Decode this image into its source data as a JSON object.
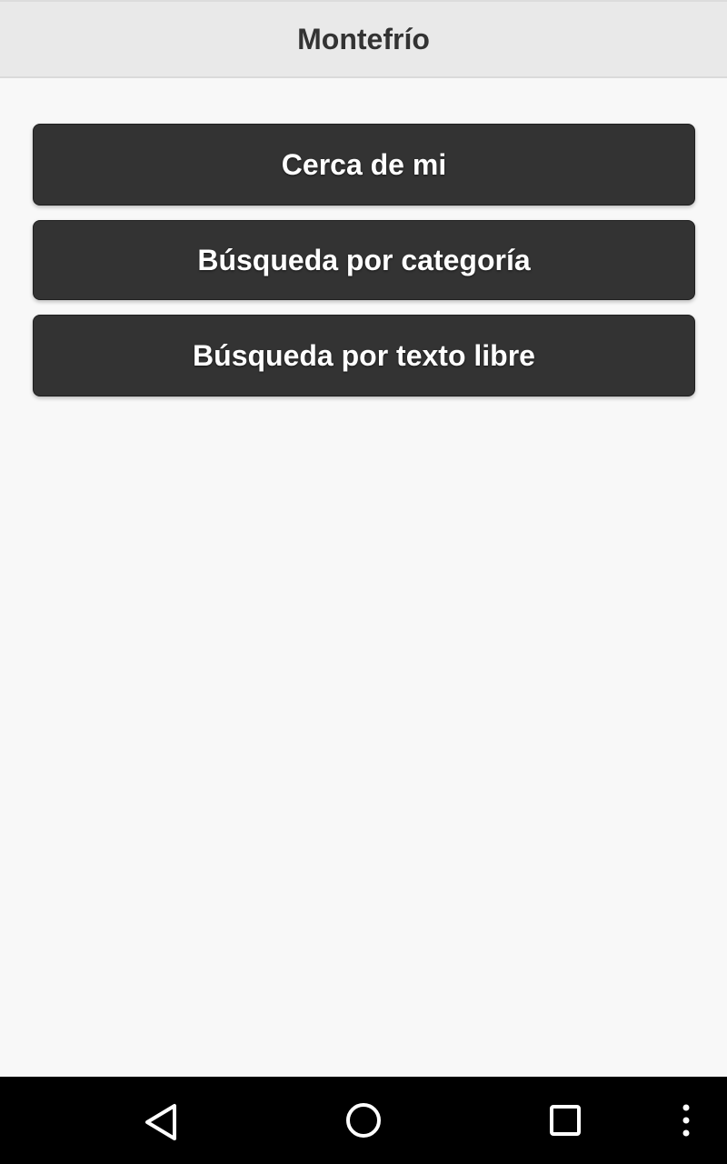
{
  "header": {
    "title": "Montefrío"
  },
  "menu": {
    "buttons": [
      {
        "label": "Cerca de mi"
      },
      {
        "label": "Búsqueda por categoría"
      },
      {
        "label": "Búsqueda por texto libre"
      }
    ]
  },
  "navbar": {
    "icons": [
      "back-icon",
      "home-icon",
      "recents-icon",
      "overflow-menu-icon"
    ]
  },
  "colors": {
    "header_bg": "#e9e9e9",
    "page_bg": "#f8f8f8",
    "button_bg": "#333333",
    "button_text": "#ffffff",
    "navbar_bg": "#000000"
  }
}
